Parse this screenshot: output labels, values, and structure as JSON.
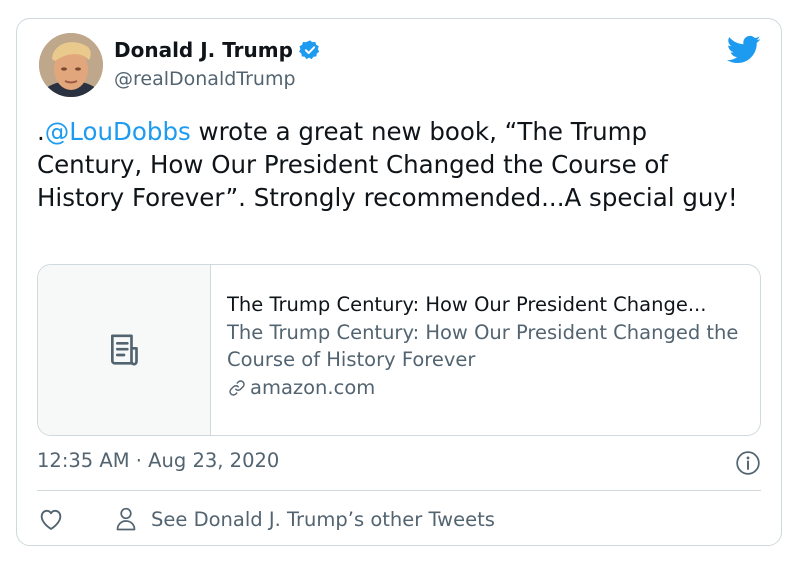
{
  "author": {
    "name": "Donald J. Trump",
    "handle": "@realDonaldTrump",
    "verified": true
  },
  "tweet": {
    "prefix": ".",
    "mention": "@LouDobbs",
    "body": " wrote a great new book, “The Trump Century, How Our President Changed the Course of History Forever”. Strongly recommended...A special guy!"
  },
  "link_card": {
    "title": "The Trump Century: How Our President Change...",
    "description": "The Trump Century: How Our President Changed the Course of History Forever",
    "domain": "amazon.com",
    "thumb_icon": "document-icon"
  },
  "meta": {
    "time": "12:35 AM",
    "separator": "·",
    "date": "Aug 23, 2020"
  },
  "actions": {
    "like_icon": "heart-icon",
    "other_tweets_label": "See Donald J. Trump’s other Tweets"
  },
  "colors": {
    "accent": "#1d9bf0",
    "text": "#0f1419",
    "secondary": "#536471",
    "border": "#cfd9de"
  }
}
